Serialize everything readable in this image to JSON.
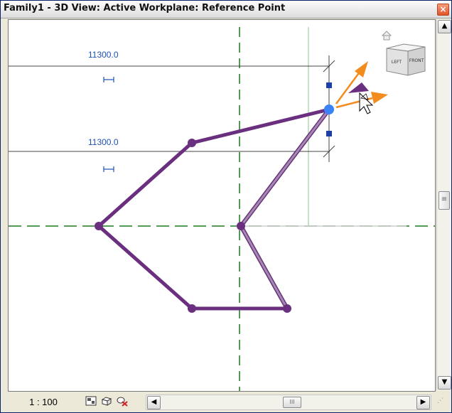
{
  "window": {
    "title": "Family1 - 3D View: Active Workplane: Reference Point",
    "close_glyph": "×"
  },
  "view": {
    "dimensions": [
      {
        "value": "11300.0"
      },
      {
        "value": "11300.0"
      }
    ],
    "viewcube": {
      "face_left": "LEFT",
      "face_right": "FRONT"
    },
    "colors": {
      "spline": "#6a2f7f",
      "reference_line": "#a48aae",
      "ref_plane": "#1b7a1b",
      "dimension": "#1e4fb4",
      "selected_point": "#3b82f6",
      "grip": "#1a3fa8",
      "arrow": "#f28c1e"
    }
  },
  "status": {
    "scale": "1 : 100",
    "icons": [
      "detail-level-icon",
      "visual-style-icon",
      "hide-isolate-icon"
    ]
  },
  "scrollbar": {
    "up": "▲",
    "down": "▼",
    "left": "◀",
    "right": "▶",
    "thumb_grip": "III",
    "v_thumb_grip": "≡"
  }
}
